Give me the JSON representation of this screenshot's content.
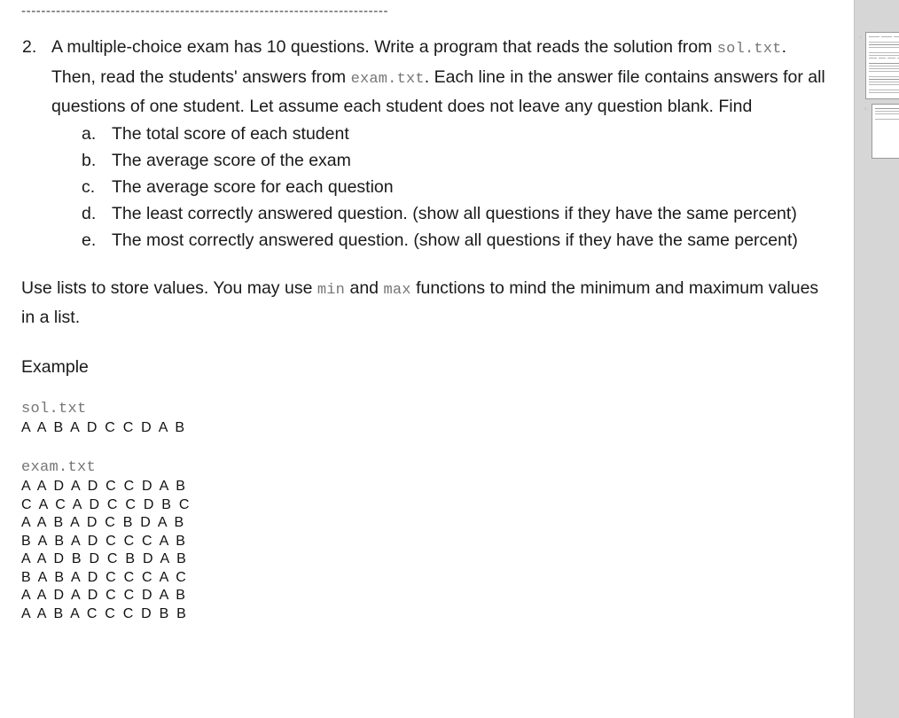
{
  "document": {
    "divider": "--------------------------------------------------------------------------",
    "question": {
      "number": "2.",
      "text_part1": "A multiple-choice exam has 10 questions. Write a program that reads the solution from ",
      "code1": "sol.txt",
      "text_part2": ". Then, read the students' answers from ",
      "code2": "exam.txt",
      "text_part3": ". Each line in the answer file contains answers for all questions of one student. Let assume each student does not leave any question blank. Find",
      "subitems": [
        {
          "marker": "a.",
          "text": "The total score of each student"
        },
        {
          "marker": "b.",
          "text": "The average score of the exam"
        },
        {
          "marker": "c.",
          "text": "The average score for each question"
        },
        {
          "marker": "d.",
          "text": "The least correctly answered question. (show all questions if they have the same percent)"
        },
        {
          "marker": "e.",
          "text": "The most correctly answered question. (show all questions if they have the same percent)"
        }
      ]
    },
    "hint": {
      "text_part1": "Use lists to store values. You may use ",
      "code1": "min",
      "text_part2": " and ",
      "code2": "max",
      "text_part3": " functions to mind the minimum and maximum values in a list."
    },
    "example_label": "Example",
    "sol_file": {
      "name": "sol.txt",
      "rows": [
        "A  A  B  A  D  C  C  D  A  B"
      ]
    },
    "exam_file": {
      "name": "exam.txt",
      "rows": [
        "A  A  D  A  D  C  C  D  A  B",
        "C  A  C  A  D  C  C  D  B  C",
        "A  A  B  A  D  C  B  D  A  B",
        "B  A  B  A  D  C  C  C  A  B",
        "A  A  D  B  D  C  B  D  A  B",
        "B  A  B  A  D  C  C  C  A  C",
        "A  A  D  A  D  C  C  D  A  B",
        "A  A  B  A  C  C  C  D  B  B"
      ]
    }
  },
  "thumbnails": {
    "pages": [
      {
        "label": "page-1"
      },
      {
        "label": "page-2"
      }
    ]
  },
  "colors": {
    "text": "#1a1a1a",
    "code": "#767676",
    "sidebar_bg": "#d6d6d6",
    "thumb_border": "#9a9a9a"
  }
}
